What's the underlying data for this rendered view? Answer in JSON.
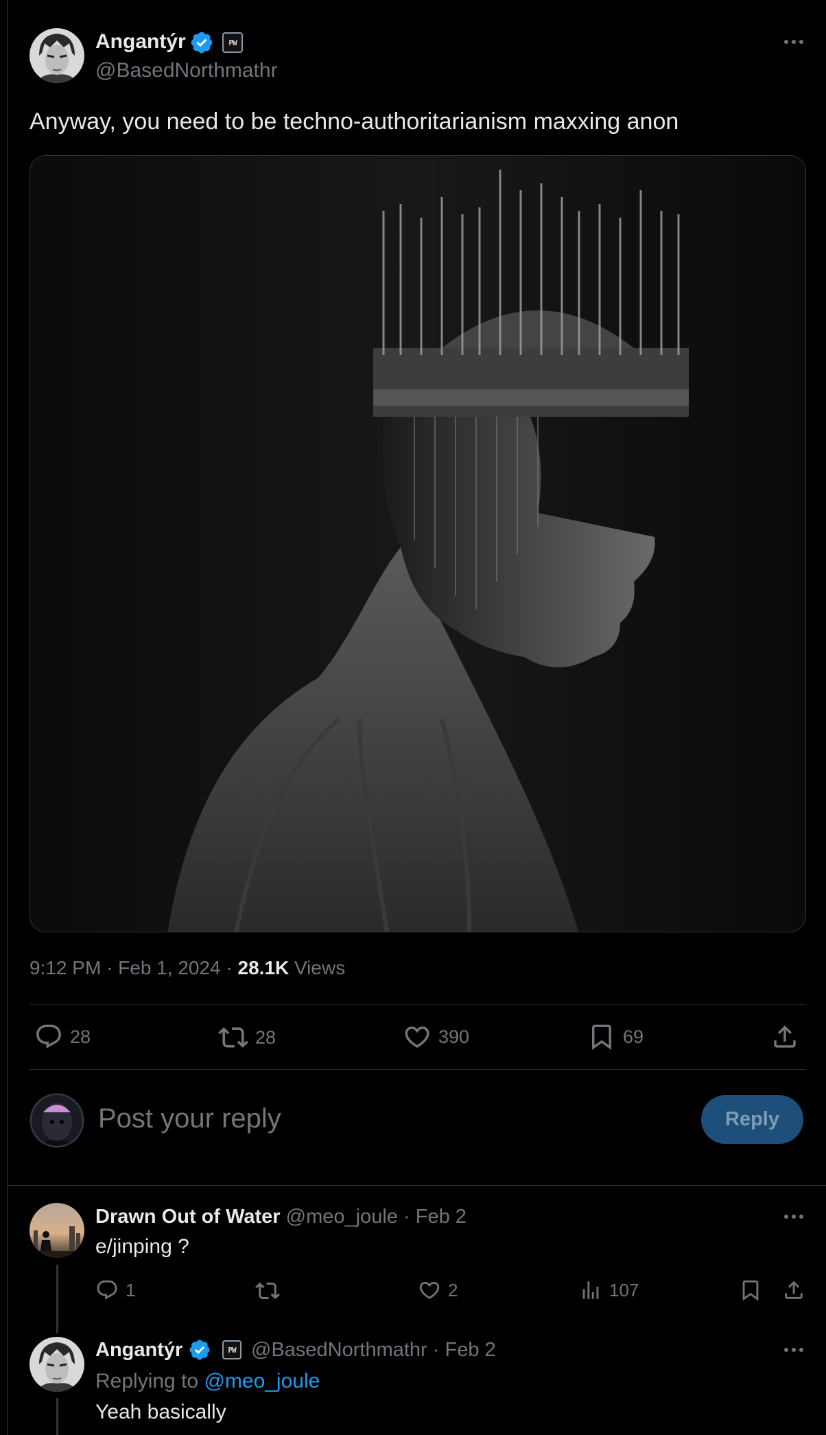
{
  "main_post": {
    "author_name": "Angantýr",
    "author_handle": "@BasedNorthmathr",
    "affiliate_badge": "PW",
    "text": "Anyway, you need to be techno-authoritarianism maxxing anon",
    "time": "9:12 PM",
    "date": "Feb 1, 2024",
    "views_count": "28.1K",
    "views_label": "Views",
    "separator": "·",
    "actions": {
      "replies": "28",
      "reposts": "28",
      "likes": "390",
      "bookmarks": "69"
    }
  },
  "composer": {
    "placeholder": "Post your reply",
    "button_label": "Reply"
  },
  "replies": [
    {
      "author_name": "Drawn Out of Water",
      "author_handle": "@meo_joule",
      "date": "Feb 2",
      "text": "e/jinping ?",
      "actions": {
        "replies": "1",
        "reposts": "",
        "likes": "2",
        "views": "107"
      }
    },
    {
      "author_name": "Angantýr",
      "author_handle": "@BasedNorthmathr",
      "affiliate_badge": "PW",
      "date": "Feb 2",
      "replying_to_label": "Replying to",
      "replying_to_handle": "@meo_joule",
      "text": "Yeah basically"
    }
  ],
  "colors": {
    "background": "#000000",
    "text": "#e7e9ea",
    "muted": "#71767b",
    "accent": "#1d9bf0",
    "divider": "#2f3336",
    "reply_button": "#1d4f7a"
  },
  "icons": [
    "more-icon",
    "verified-icon",
    "reply-icon",
    "repost-icon",
    "like-icon",
    "bookmark-icon",
    "share-icon",
    "views-icon"
  ]
}
